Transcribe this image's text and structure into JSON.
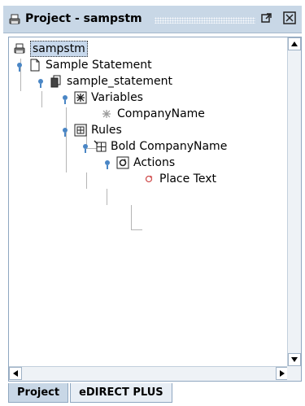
{
  "window": {
    "title": "Project - sampstm",
    "icons": {
      "title": "printer-icon",
      "maximize": "maximize-icon",
      "close": "close-icon"
    },
    "accent_color": "#c8d7e6"
  },
  "tree": {
    "root": {
      "label": "sampstm",
      "icon": "printer-icon",
      "selected": true
    },
    "nodes": [
      {
        "label": "Sample Statement",
        "icon": "document-icon"
      },
      {
        "label": "sample_statement",
        "icon": "documents-icon"
      },
      {
        "label": "Variables",
        "icon": "variables-icon"
      },
      {
        "label": "CompanyName",
        "icon": "variable-icon"
      },
      {
        "label": "Rules",
        "icon": "rules-icon"
      },
      {
        "label": "Bold CompanyName",
        "icon": "rule-icon"
      },
      {
        "label": "Actions",
        "icon": "actions-icon"
      },
      {
        "label": "Place Text",
        "icon": "place-text-icon"
      }
    ]
  },
  "tabs": [
    {
      "label": "Project",
      "active": true
    },
    {
      "label": "eDIRECT PLUS",
      "active": false
    }
  ]
}
